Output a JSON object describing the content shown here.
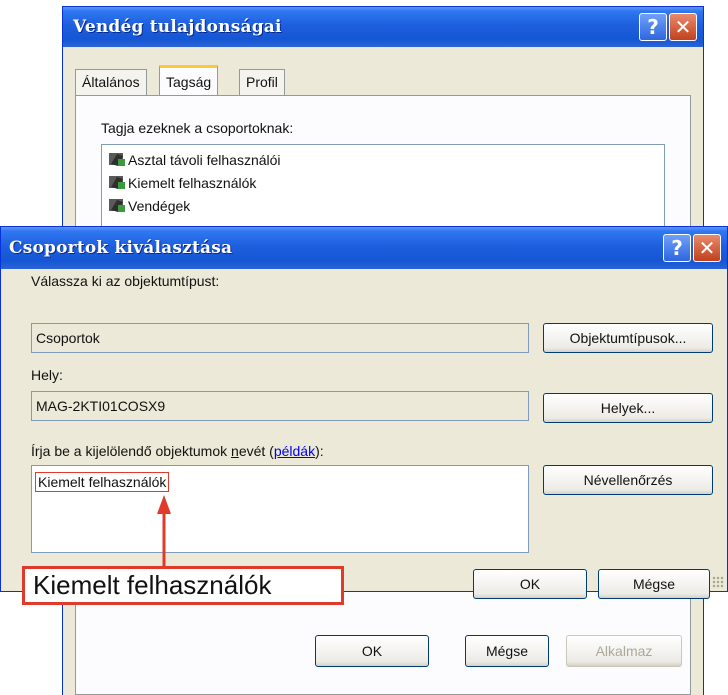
{
  "back_window": {
    "title": "Vendég tulajdonságai",
    "tabs": [
      "Általános",
      "Tagság",
      "Profil"
    ],
    "active_tab": "Tagság",
    "member_label": "Tagja ezeknek a csoportoknak:",
    "groups": [
      "Asztal távoli felhasználói",
      "Kiemelt felhasználók",
      "Vendégek"
    ],
    "ok_label": "OK",
    "cancel_label": "Mégse",
    "apply_label": "Alkalmaz"
  },
  "dialog": {
    "title": "Csoportok kiválasztása",
    "object_type_label": "Válassza ki az objektumtípust:",
    "object_type_value": "Csoportok",
    "object_types_button": "Objektumtípusok...",
    "location_label": "Hely:",
    "location_value": "MAG-2KTI01COSX9",
    "locations_button": "Helyek...",
    "names_label_part1": "Írja be a kijelölendő objektumok ",
    "names_label_part2": "n",
    "names_label_part3": "evét (",
    "names_label_link": "példák",
    "names_label_part4": "):",
    "names_value": "Kiemelt felhasználók",
    "check_names_button": "Névellenőrzés",
    "ok_label": "OK",
    "cancel_label": "Mégse"
  },
  "annotation": {
    "callout_text": "Kiemelt felhasználók",
    "color": "#e03a2a"
  },
  "colors": {
    "title_blue": "#1e5fdf",
    "dialog_bg": "#ece9d8",
    "tab_highlight": "#ffc83c"
  }
}
